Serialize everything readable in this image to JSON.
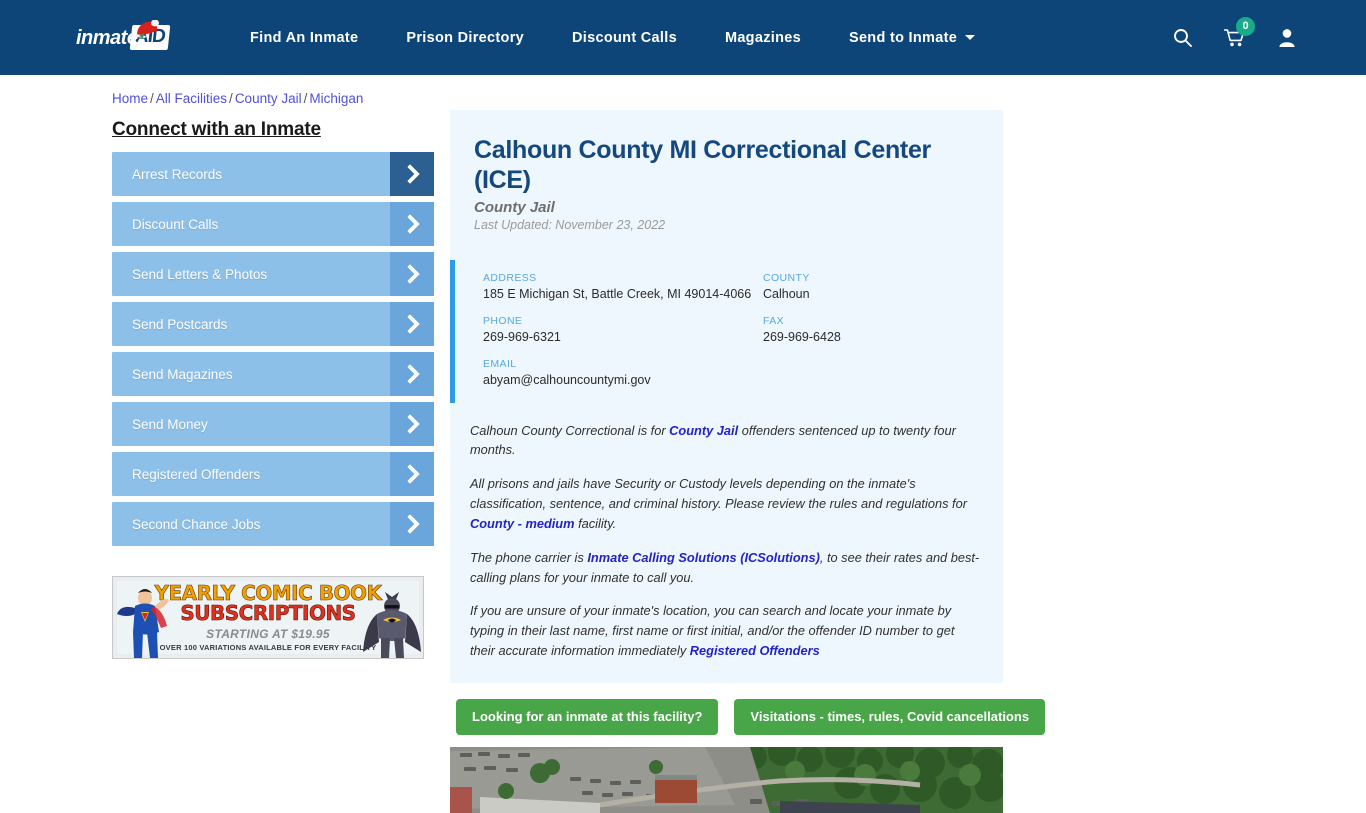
{
  "site": {
    "logo_text": "inmate",
    "logo_badge": "AID",
    "logo_icon": "santa-hat-icon"
  },
  "nav": {
    "links": [
      {
        "label": "Find An Inmate",
        "dropdown": false
      },
      {
        "label": "Prison Directory",
        "dropdown": false
      },
      {
        "label": "Discount Calls",
        "dropdown": false
      },
      {
        "label": "Magazines",
        "dropdown": false
      },
      {
        "label": "Send to Inmate",
        "dropdown": true
      }
    ],
    "search_icon": "search-icon",
    "cart_icon": "shopping-cart-icon",
    "cart_count": "0",
    "account_icon": "user-account-icon",
    "bar_color": "#0d4578"
  },
  "breadcrumb": {
    "items": [
      "Home",
      "All Facilities",
      "County Jail",
      "Michigan"
    ],
    "separator": "/"
  },
  "sidebar": {
    "title": "Connect with an Inmate",
    "items": [
      {
        "label": "Arrest Records",
        "active": true
      },
      {
        "label": "Discount Calls",
        "active": false
      },
      {
        "label": "Send Letters & Photos",
        "active": false
      },
      {
        "label": "Send Postcards",
        "active": false
      },
      {
        "label": "Send Magazines",
        "active": false
      },
      {
        "label": "Send Money",
        "active": false
      },
      {
        "label": "Registered Offenders",
        "active": false
      },
      {
        "label": "Second Chance Jobs",
        "active": false
      }
    ],
    "ad": {
      "line1": "YEARLY COMIC BOOK",
      "line2": "SUBSCRIPTIONS",
      "line3": "STARTING AT $19.95",
      "line4": "OVER 100 VARIATIONS AVAILABLE FOR EVERY FACILITY",
      "left_figure": "superman-figure",
      "right_figure": "batman-figure"
    }
  },
  "facility": {
    "name": "Calhoun County MI Correctional Center (ICE)",
    "type": "County Jail",
    "last_updated": "Last Updated: November 23, 2022",
    "accent_color": "#2f9ae8",
    "panel_bg": "#eef7fd",
    "info": [
      {
        "label": "ADDRESS",
        "value": "185 E Michigan St, Battle Creek, MI 49014-4066"
      },
      {
        "label": "COUNTY",
        "value": "Calhoun"
      },
      {
        "label": "PHONE",
        "value": "269-969-6321"
      },
      {
        "label": "FAX",
        "value": "269-969-6428"
      },
      {
        "label": "EMAIL",
        "value": "abyam@calhouncountymi.gov"
      }
    ],
    "description": {
      "p1_a": "Calhoun County Correctional is for ",
      "p1_link": "County Jail",
      "p1_b": " offenders sentenced up to twenty four months.",
      "p2_a": "All prisons and jails have Security or Custody levels depending on the inmate's classification, sentence, and criminal history. Please review the rules and regulations for ",
      "p2_link": "County - medium",
      "p2_b": " facility.",
      "p3_a": "The phone carrier is ",
      "p3_link": "Inmate Calling Solutions (ICSolutions)",
      "p3_b": ", to see their rates and best-calling plans for your inmate to call you.",
      "p4_a": "If you are unsure of your inmate's location, you can search and locate your inmate by typing in their last name, first name or first initial, and/or the offender ID number to get their accurate information immediately ",
      "p4_link": "Registered Offenders"
    },
    "actions": [
      {
        "label": "Looking for an inmate at this facility?",
        "color": "#48a548"
      },
      {
        "label": "Visitations - times, rules, Covid cancellations",
        "color": "#48a548"
      }
    ],
    "photo": "aerial-facility-photo"
  }
}
